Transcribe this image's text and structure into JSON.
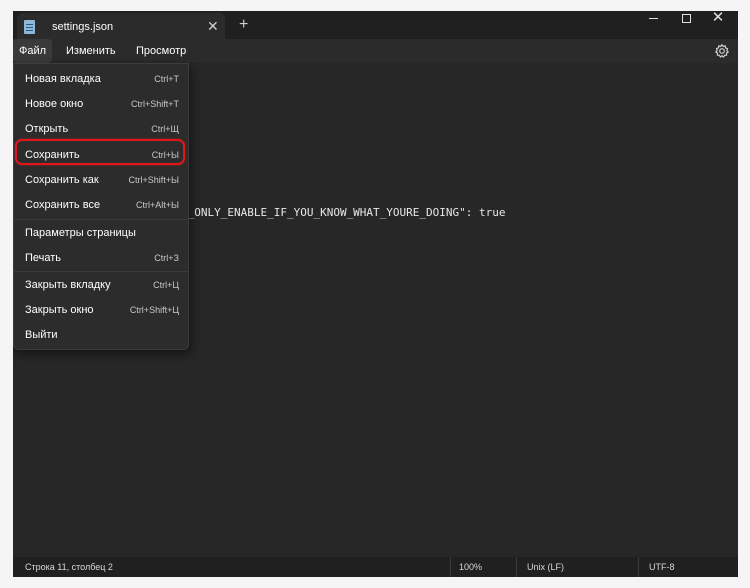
{
  "tab": {
    "title": "settings.json",
    "close": "✕",
    "new_tab": "+"
  },
  "window_controls": {
    "minimize": "",
    "maximize": "",
    "close": "✕"
  },
  "menubar": {
    "file": "Файл",
    "edit": "Изменить",
    "view": "Просмотр",
    "settings_icon": "gear-icon"
  },
  "editor": {
    "visible_line": "S_ONLY_ENABLE_IF_YOU_KNOW_WHAT_YOURE_DOING\": true"
  },
  "file_menu": {
    "items": [
      {
        "label": "Новая вкладка",
        "shortcut": "Ctrl+T"
      },
      {
        "label": "Новое окно",
        "shortcut": "Ctrl+Shift+T"
      },
      {
        "label": "Открыть",
        "shortcut": "Ctrl+Щ"
      },
      {
        "label": "Сохранить",
        "shortcut": "Ctrl+Ы",
        "highlighted": true
      },
      {
        "label": "Сохранить как",
        "shortcut": "Ctrl+Shift+Ы"
      },
      {
        "label": "Сохранить все",
        "shortcut": "Ctrl+Alt+Ы"
      },
      {
        "label": "Параметры страницы",
        "shortcut": ""
      },
      {
        "label": "Печать",
        "shortcut": "Ctrl+З"
      },
      {
        "label": "Закрыть вкладку",
        "shortcut": "Ctrl+Ц"
      },
      {
        "label": "Закрыть окно",
        "shortcut": "Ctrl+Shift+Ц"
      },
      {
        "label": "Выйти",
        "shortcut": ""
      }
    ]
  },
  "status": {
    "position": "Строка 11, столбец 2",
    "zoom": "100%",
    "line_endings": "Unix (LF)",
    "encoding": "UTF-8"
  },
  "colors": {
    "highlight_border": "#e0161b",
    "background": "#272727"
  }
}
